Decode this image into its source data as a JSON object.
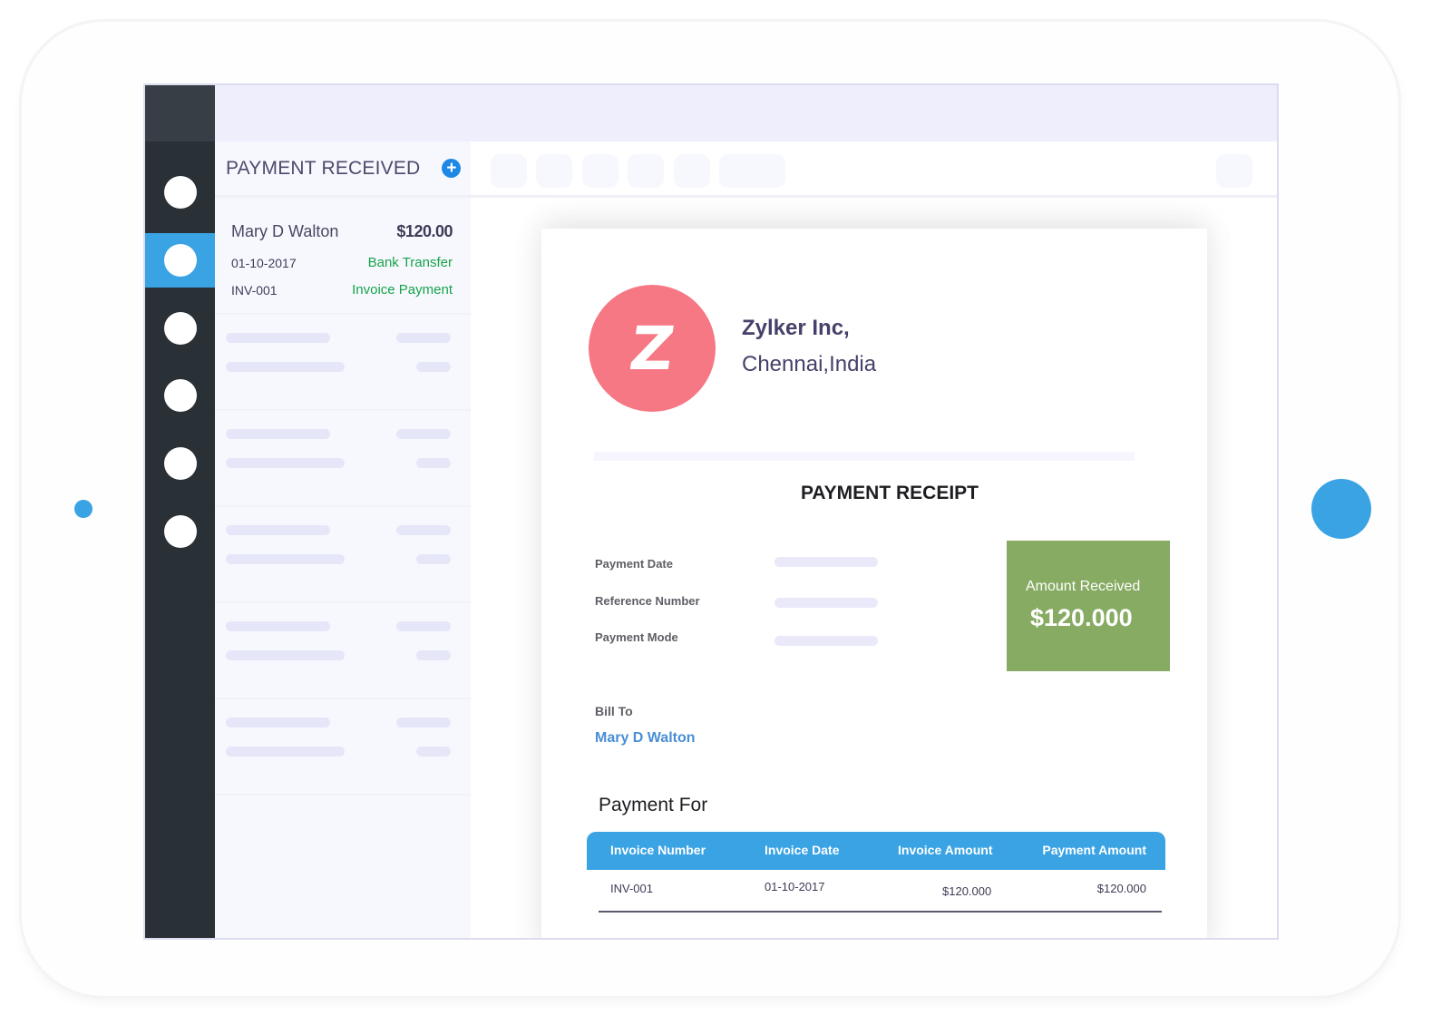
{
  "sidebar": {
    "items": [
      {
        "name": "nav-item-1",
        "active": false
      },
      {
        "name": "nav-item-2",
        "active": true
      },
      {
        "name": "nav-item-3",
        "active": false
      },
      {
        "name": "nav-item-4",
        "active": false
      },
      {
        "name": "nav-item-5",
        "active": false
      },
      {
        "name": "nav-item-6",
        "active": false
      }
    ]
  },
  "list": {
    "title": "PAYMENT RECEIVED",
    "add_icon": "plus-circle-icon",
    "add_label": "+",
    "selected": {
      "customer": "Mary D Walton",
      "amount": "$120.00",
      "date": "01-10-2017",
      "mode": "Bank Transfer",
      "reference": "INV-001",
      "type": "Invoice Payment"
    },
    "placeholder_rows": 5
  },
  "colors": {
    "accent": "#3aa3e3",
    "rail": "#293036",
    "success": "#17a34a",
    "amount_box": "#87ab63",
    "logo": "#f67884"
  },
  "receipt": {
    "logo_letter": "Z",
    "org_name": "Zylker Inc,",
    "org_location": "Chennai,India",
    "title": "PAYMENT RECEIPT",
    "fields": [
      {
        "label": "Payment Date"
      },
      {
        "label": "Reference Number"
      },
      {
        "label": "Payment Mode"
      }
    ],
    "amount_label": "Amount Received",
    "amount_value": "$120.000",
    "bill_to_label": "Bill To",
    "bill_to_name": "Mary D Walton",
    "payment_for_title": "Payment For",
    "table": {
      "headers": [
        "Invoice Number",
        "Invoice Date",
        "Invoice Amount",
        "Payment Amount"
      ],
      "rows": [
        [
          "INV-001",
          "01-10-2017",
          "$120.000",
          "$120.000"
        ]
      ]
    }
  }
}
